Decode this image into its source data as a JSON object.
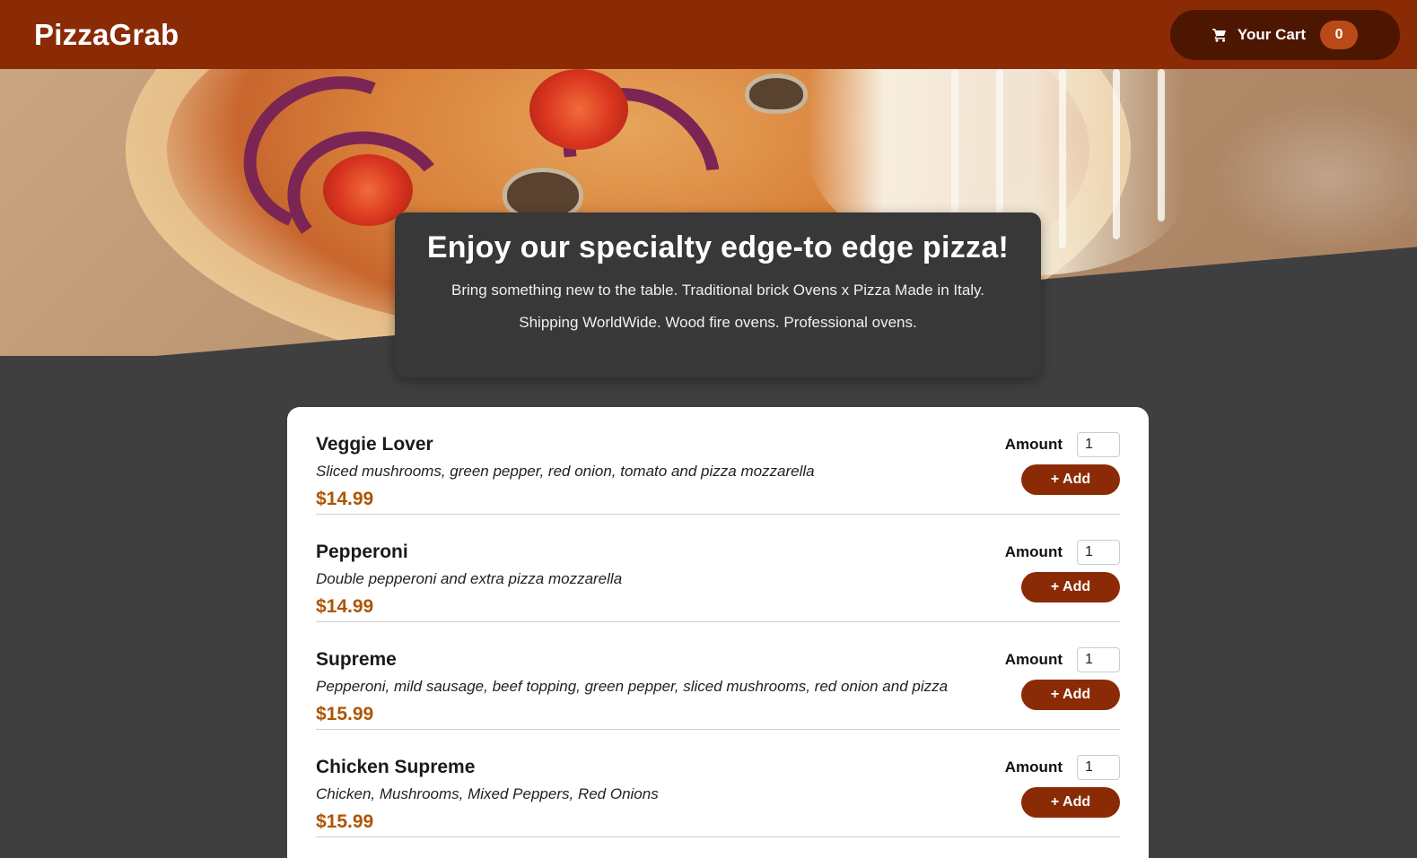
{
  "header": {
    "brand": "PizzaGrab",
    "cart_label": "Your Cart",
    "cart_count": "0",
    "cart_icon": "cart-icon"
  },
  "hero": {
    "title": "Enjoy our specialty edge-to edge pizza!",
    "line1": "Bring something new to the table. Traditional brick Ovens x Pizza Made in Italy.",
    "line2": "Shipping WorldWide. Wood fire ovens. Professional ovens."
  },
  "colors": {
    "header_bg": "#8a2b06",
    "cart_bg": "#4d1601",
    "badge_bg": "#b94a17",
    "page_bg": "#3f3f3f",
    "price": "#ad5502",
    "button": "#8a2b06"
  },
  "meals": [
    {
      "name": "Veggie Lover",
      "description": "Sliced mushrooms, green pepper, red onion, tomato and pizza mozzarella",
      "price": "$14.99",
      "amount_label": "Amount",
      "amount": "1",
      "add_label": "+ Add"
    },
    {
      "name": "Pepperoni",
      "description": "Double pepperoni and extra pizza mozzarella",
      "price": "$14.99",
      "amount_label": "Amount",
      "amount": "1",
      "add_label": "+ Add"
    },
    {
      "name": "Supreme",
      "description": "Pepperoni, mild sausage, beef topping, green pepper, sliced mushrooms, red onion and pizza",
      "price": "$15.99",
      "amount_label": "Amount",
      "amount": "1",
      "add_label": "+ Add"
    },
    {
      "name": "Chicken Supreme",
      "description": "Chicken, Mushrooms, Mixed Peppers, Red Onions",
      "price": "$15.99",
      "amount_label": "Amount",
      "amount": "1",
      "add_label": "+ Add"
    }
  ]
}
